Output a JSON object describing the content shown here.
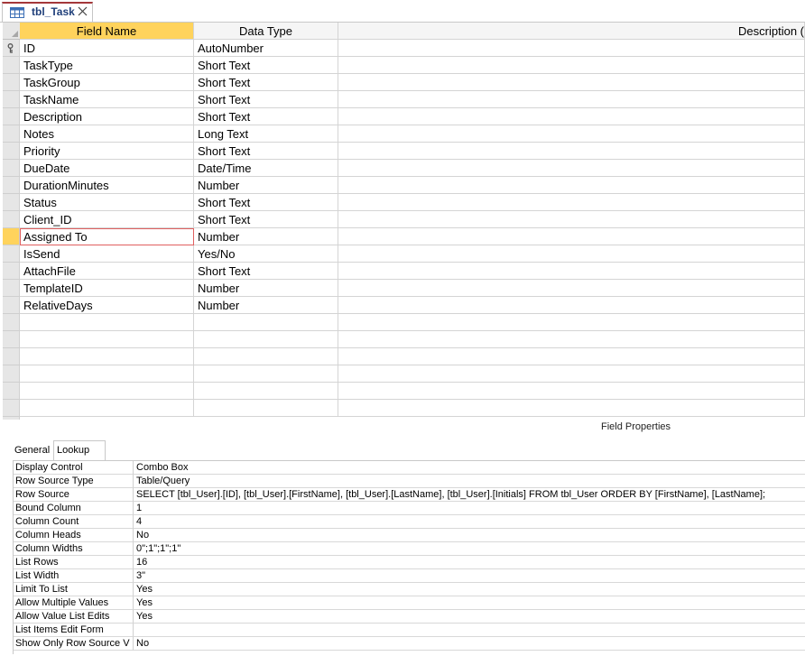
{
  "tab": {
    "title": "tbl_Task"
  },
  "columns": {
    "field_name": "Field Name",
    "data_type": "Data Type",
    "description": "Description ("
  },
  "fields": [
    {
      "name": "ID",
      "type": "AutoNumber"
    },
    {
      "name": "TaskType",
      "type": "Short Text"
    },
    {
      "name": "TaskGroup",
      "type": "Short Text"
    },
    {
      "name": "TaskName",
      "type": "Short Text"
    },
    {
      "name": "Description",
      "type": "Short Text"
    },
    {
      "name": "Notes",
      "type": "Long Text"
    },
    {
      "name": "Priority",
      "type": "Short Text"
    },
    {
      "name": "DueDate",
      "type": "Date/Time"
    },
    {
      "name": "DurationMinutes",
      "type": "Number"
    },
    {
      "name": "Status",
      "type": "Short Text"
    },
    {
      "name": "Client_ID",
      "type": "Short Text"
    },
    {
      "name": "Assigned To",
      "type": "Number"
    },
    {
      "name": "IsSend",
      "type": "Yes/No"
    },
    {
      "name": "AttachFile",
      "type": "Short Text"
    },
    {
      "name": "TemplateID",
      "type": "Number"
    },
    {
      "name": "RelativeDays",
      "type": "Number"
    }
  ],
  "primary_key_row": 0,
  "current_row": 11,
  "field_properties": {
    "title": "Field Properties",
    "tabs": {
      "general": "General",
      "lookup": "Lookup"
    },
    "rows": [
      {
        "name": "Display Control",
        "value": "Combo Box"
      },
      {
        "name": "Row Source Type",
        "value": "Table/Query"
      },
      {
        "name": "Row Source",
        "value": "SELECT [tbl_User].[ID], [tbl_User].[FirstName], [tbl_User].[LastName], [tbl_User].[Initials] FROM tbl_User ORDER BY [FirstName], [LastName];"
      },
      {
        "name": "Bound Column",
        "value": "1"
      },
      {
        "name": "Column Count",
        "value": "4"
      },
      {
        "name": "Column Heads",
        "value": "No"
      },
      {
        "name": "Column Widths",
        "value": "0\";1\";1\";1\""
      },
      {
        "name": "List Rows",
        "value": "16"
      },
      {
        "name": "List Width",
        "value": "3\""
      },
      {
        "name": "Limit To List",
        "value": "Yes"
      },
      {
        "name": "Allow Multiple Values",
        "value": "Yes"
      },
      {
        "name": "Allow Value List Edits",
        "value": "Yes"
      },
      {
        "name": "List Items Edit Form",
        "value": ""
      },
      {
        "name": "Show Only Row Source V",
        "value": "No"
      }
    ]
  }
}
